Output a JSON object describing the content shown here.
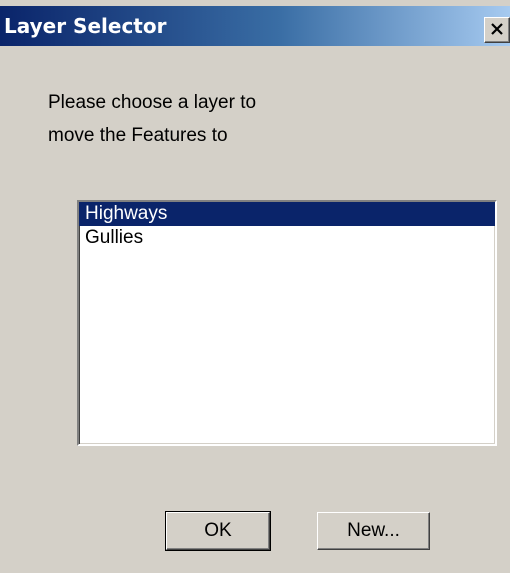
{
  "window": {
    "title": "Layer Selector"
  },
  "prompt": {
    "line1": "Please choose a layer to",
    "line2": "move the Features to"
  },
  "layers": {
    "items": [
      {
        "label": "Highways",
        "selected": true
      },
      {
        "label": "Gullies",
        "selected": false
      }
    ]
  },
  "buttons": {
    "ok_label": "OK",
    "new_label": "New..."
  },
  "colors": {
    "titlebar_start": "#0a246a",
    "titlebar_end": "#a6caf0",
    "selection": "#0a246a",
    "window_background": "#d4d0c8"
  },
  "icons": {
    "close": "close-icon"
  }
}
